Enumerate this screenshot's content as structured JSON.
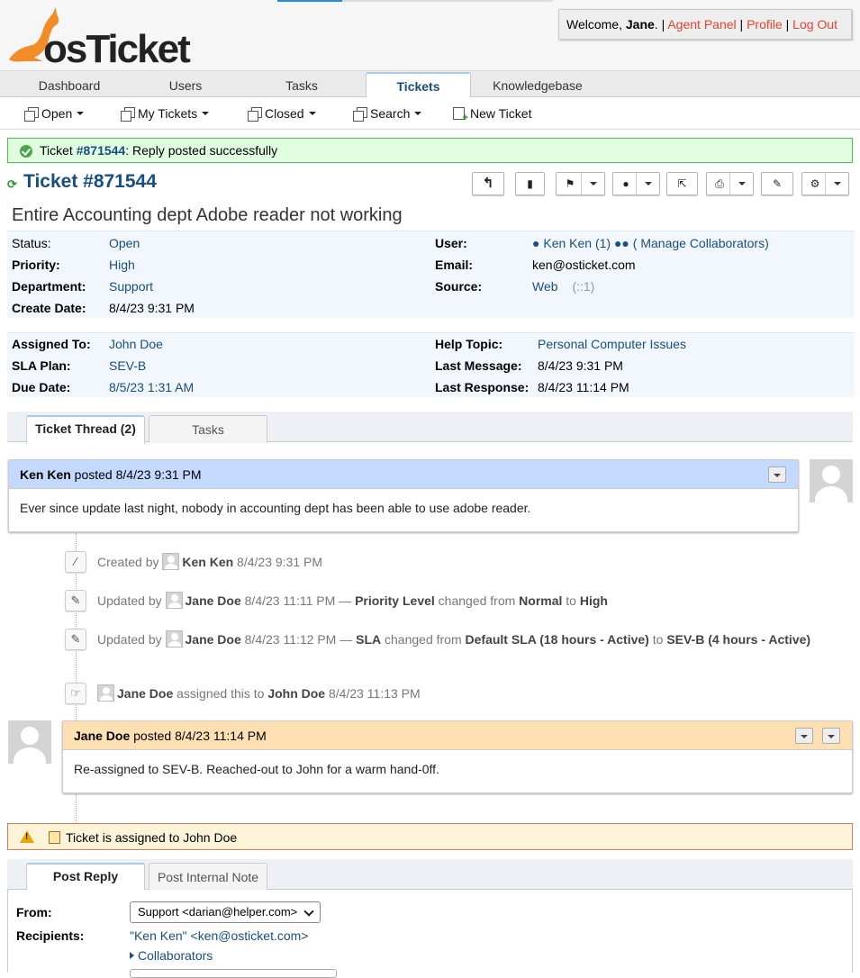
{
  "header": {
    "logo_text": "osTicket",
    "welcome_prefix": "Welcome, ",
    "user_name": "Jane",
    "welcome_suffix": ". |",
    "agent_panel": "Agent Panel",
    "profile": "Profile",
    "logout": "Log Out",
    "sep": "|"
  },
  "nav": {
    "tabs": [
      "Dashboard",
      "Users",
      "Tasks",
      "Tickets",
      "Knowledgebase"
    ],
    "active": "Tickets"
  },
  "subnav": {
    "open": "Open",
    "my_tickets": "My Tickets",
    "closed": "Closed",
    "search": "Search",
    "new_ticket": "New Ticket"
  },
  "notice": {
    "prefix": "Ticket ",
    "ticket_link": "#871544",
    "message": ": Reply posted successfully"
  },
  "ticket": {
    "title": "Ticket #871544",
    "subject": "Entire Accounting dept Adobe reader not working"
  },
  "info1": {
    "status_label": "Status:",
    "status": "Open",
    "priority_label": "Priority:",
    "priority": "High",
    "department_label": "Department:",
    "department": "Support",
    "create_label": "Create Date:",
    "create_date": "8/4/23 9:31 PM",
    "user_label": "User:",
    "user": "Ken Ken (1)",
    "collab": "( Manage Collaborators)",
    "email_label": "Email:",
    "email": "ken@osticket.com",
    "source_label": "Source:",
    "source": "Web",
    "source_ip": "(::1)"
  },
  "info2": {
    "assigned_label": "Assigned To:",
    "assigned": "John Doe",
    "sla_label": "SLA Plan:",
    "sla": "SEV-B",
    "due_label": "Due Date:",
    "due": "8/5/23 1:31 AM",
    "topic_label": "Help Topic:",
    "topic": "Personal Computer Issues",
    "lastmsg_label": "Last Message:",
    "lastmsg": "8/4/23 9:31 PM",
    "lastresp_label": "Last Response:",
    "lastresp": "8/4/23 11:14 PM"
  },
  "thread_tabs": {
    "thread": "Ticket Thread (2)",
    "tasks": "Tasks"
  },
  "entry1": {
    "author": "Ken Ken",
    "posted": " posted 8/4/23 9:31 PM",
    "body": "Ever since update last night, nobody in accounting dept has been able to use adobe reader.",
    "color": "#c3d9ff"
  },
  "events": {
    "e1": {
      "pre": "Created by ",
      "who": "Ken Ken",
      "rest": " 8/4/23 9:31 PM"
    },
    "e2": {
      "pre": "Updated by ",
      "who": "Jane Doe",
      "mid": " 8/4/23 11:11 PM — ",
      "field": "Priority Level",
      "changed": " changed from ",
      "from": "Normal",
      "to_word": " to ",
      "to": "High"
    },
    "e3": {
      "pre": "Updated by ",
      "who": "Jane Doe",
      "mid": " 8/4/23 11:12 PM — ",
      "field": "SLA",
      "changed": " changed from ",
      "from": "Default SLA (18 hours - Active)",
      "to_word": " to ",
      "to": "SEV-B (4 hours - Active)"
    },
    "e4": {
      "who": "Jane Doe",
      "mid": " assigned this to ",
      "to": "John Doe",
      "rest": " 8/4/23 11:13 PM"
    }
  },
  "entry2": {
    "author": "Jane Doe",
    "posted": " posted 8/4/23 11:14 PM",
    "body": "Re-assigned to SEV-B. Reached-out to John for a warm hand-0ff.",
    "color": "#ffe0b3"
  },
  "warning": {
    "text": "Ticket is assigned to John Doe"
  },
  "reply_tabs": {
    "post_reply": "Post Reply",
    "internal_note": "Post Internal Note"
  },
  "reply": {
    "from_label": "From:",
    "from_value": "Support <darian@helper.com>",
    "recipients_label": "Recipients:",
    "recipients_value": "\"Ken Ken\" <ken@osticket.com>",
    "collaborators": "Collaborators"
  }
}
